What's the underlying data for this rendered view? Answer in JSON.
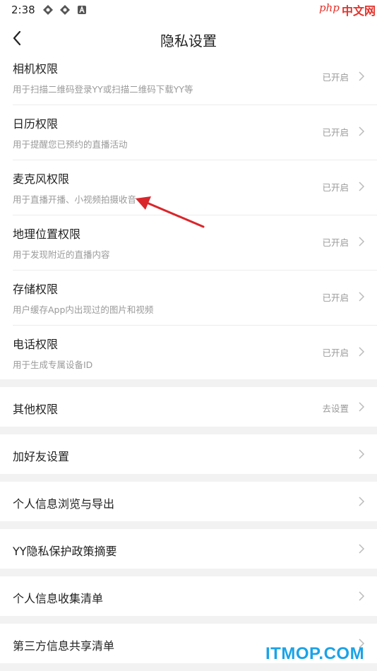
{
  "status_bar": {
    "time": "2:38",
    "icons": [
      "vpn-icon",
      "vpn-icon",
      "notification-a-icon"
    ],
    "watermark_php": "php",
    "watermark_cn": "中文网"
  },
  "header": {
    "title": "隐私设置",
    "back_icon": "chevron-left-icon"
  },
  "permissions": [
    {
      "title": "相机权限",
      "desc": "用于扫描二维码登录YY或扫描二维码下载YY等",
      "status": "已开启"
    },
    {
      "title": "日历权限",
      "desc": "用于提醒您已预约的直播活动",
      "status": "已开启"
    },
    {
      "title": "麦克风权限",
      "desc": "用于直播开播、小视频拍摄收音",
      "status": "已开启"
    },
    {
      "title": "地理位置权限",
      "desc": "用于发现附近的直播内容",
      "status": "已开启"
    },
    {
      "title": "存储权限",
      "desc": "用户缓存App内出现过的图片和视频",
      "status": "已开启"
    },
    {
      "title": "电话权限",
      "desc": "用于生成专属设备ID",
      "status": "已开启"
    }
  ],
  "menu": [
    {
      "title": "其他权限",
      "value": "去设置"
    },
    {
      "title": "加好友设置",
      "value": ""
    },
    {
      "title": "个人信息浏览与导出",
      "value": ""
    },
    {
      "title": "YY隐私保护政策摘要",
      "value": ""
    },
    {
      "title": "个人信息收集清单",
      "value": ""
    },
    {
      "title": "第三方信息共享清单",
      "value": ""
    }
  ],
  "colors": {
    "annotation_arrow": "#d9262b",
    "watermark_blue": "#1aa3e8",
    "watermark_red": "#e4322b"
  },
  "watermark_itmop": "ITMOP.COM"
}
